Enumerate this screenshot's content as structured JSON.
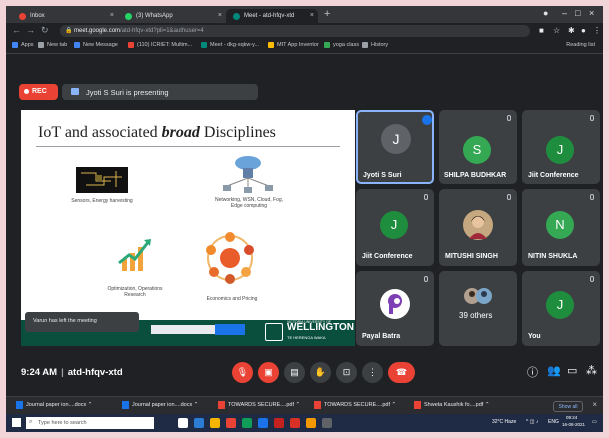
{
  "browser": {
    "tabs": [
      {
        "label": "Inbox",
        "color": "#ea4335"
      },
      {
        "label": "(3) WhatsApp",
        "color": "#25d366"
      },
      {
        "label": "Meet - atd-hfqv-xtd",
        "color": "#00897b"
      }
    ],
    "address": {
      "host": "meet.google.com",
      "path": "/atd-hfqv-xtd?pli=1&authuser=4"
    },
    "bookmarks": [
      {
        "label": "Apps",
        "color": "#4285f4"
      },
      {
        "label": "New tab",
        "color": "#9aa0a6"
      },
      {
        "label": "New Message",
        "color": "#4285f4"
      },
      {
        "label": "(110) ICRIET: Multim...",
        "color": "#ea4335"
      },
      {
        "label": "Meet - dkg-sqkw-y...",
        "color": "#00897b"
      },
      {
        "label": "MIT App Inventor",
        "color": "#fbbc04"
      },
      {
        "label": "yoga class",
        "color": "#34a853"
      },
      {
        "label": "History",
        "color": "#9aa0a6"
      }
    ],
    "reading_list": "Reading list"
  },
  "meet": {
    "rec_label": "REC",
    "presenting_label": "Jyoti S Suri is presenting",
    "meeting_time": "9:24 AM",
    "meeting_code": "atd-hfqv-xtd",
    "toast": "Varun has left the meeting"
  },
  "slide": {
    "title_prefix": "IoT and associated ",
    "title_bold": "broad",
    "title_suffix": " Disciplines",
    "captions": {
      "sensors": "Sensors, Energy harvesting",
      "networking": "Networking, WSN, Cloud, Fog, Edge computing",
      "optimization": "Optimization, Operations Research",
      "economics": "Economics and Pricing"
    },
    "university_top": "VICTORIA UNIVERSITY OF",
    "university_name": "WELLINGTON",
    "university_sub": "TE HERENGA WAKA"
  },
  "participants": [
    {
      "name": "Jyoti S Suri",
      "initial": "J",
      "color": "#5f6368"
    },
    {
      "name": "SHILPA BUDHKAR",
      "initial": "S",
      "color": "#34a853"
    },
    {
      "name": "Jiit Conference",
      "initial": "J",
      "color": "#1e8e3e"
    },
    {
      "name": "Jiit Conference",
      "initial": "J",
      "color": "#1e8e3e"
    },
    {
      "name": "MITUSHI SINGH",
      "initial": "",
      "color": "#c5a880"
    },
    {
      "name": "NITIN SHUKLA",
      "initial": "N",
      "color": "#34a853"
    },
    {
      "name": "Payal Batra",
      "initial": "",
      "color": "#ffffff"
    },
    {
      "name": "39 others",
      "initial": "",
      "color": "#9aa0a6"
    },
    {
      "name": "You",
      "initial": "J",
      "color": "#1e8e3e"
    }
  ],
  "downloads": [
    {
      "label": "Journal paper ion....docx",
      "kind": "doc"
    },
    {
      "label": "Journal paper ion....docx",
      "kind": "doc"
    },
    {
      "label": "TOWARDS SECURE....pdf",
      "kind": "pdf"
    },
    {
      "label": "TOWARDS SECURE....pdf",
      "kind": "pdf"
    },
    {
      "label": "Shweta Kaushik fo....pdf",
      "kind": "pdf"
    }
  ],
  "downloads_show_all": "Show all",
  "taskbar": {
    "search_placeholder": "Type here to search",
    "weather": "32°C Haze",
    "time": "09:24",
    "date": "16-08-2021",
    "lang": "ENG"
  }
}
